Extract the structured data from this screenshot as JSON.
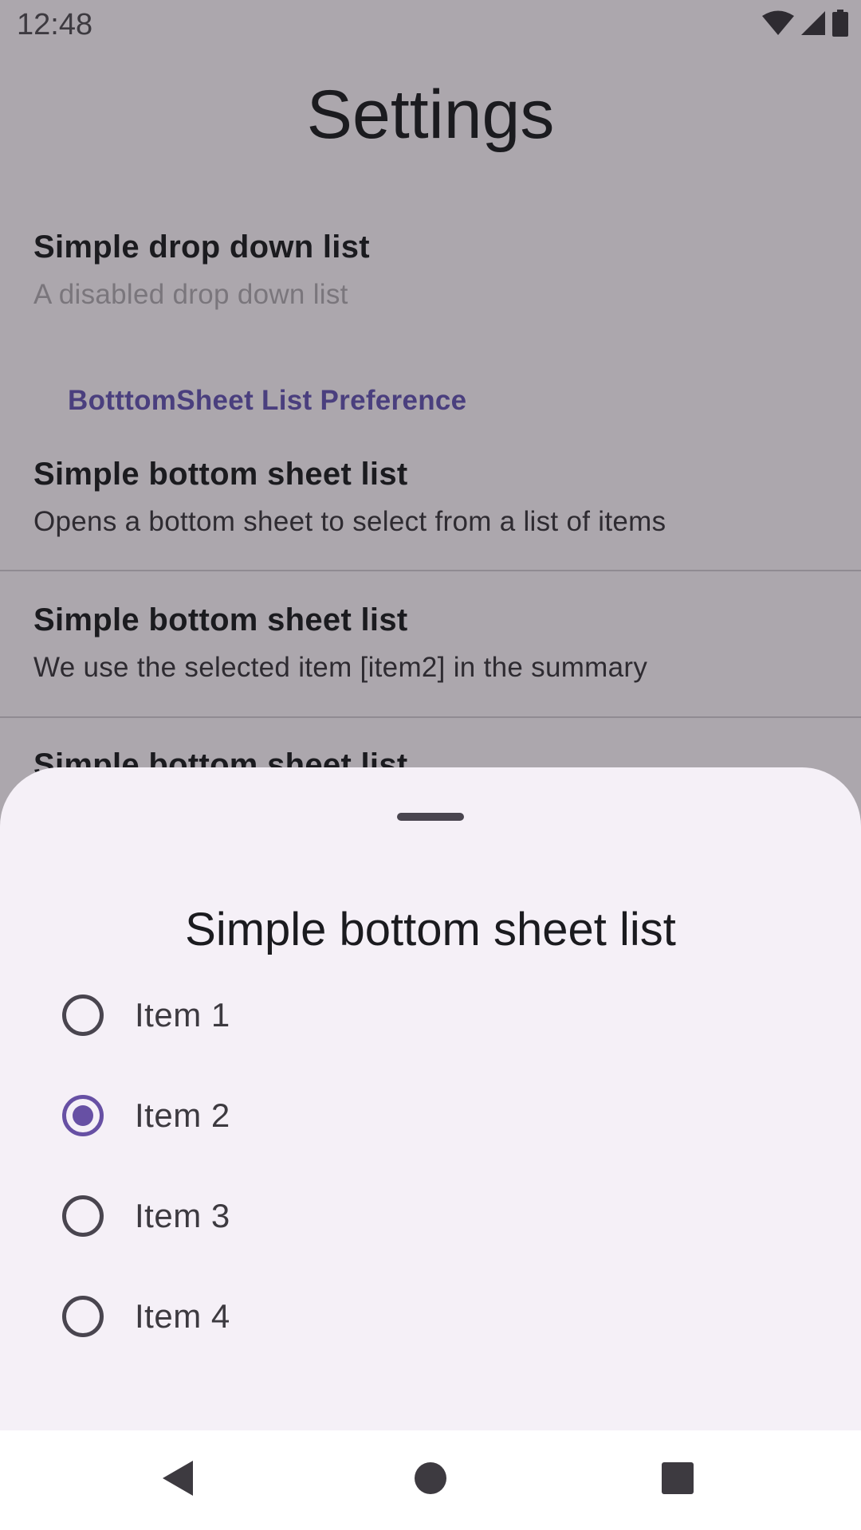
{
  "status_bar": {
    "time": "12:48",
    "icons": [
      "wifi-icon",
      "cell-signal-icon",
      "battery-icon"
    ]
  },
  "page": {
    "title": "Settings"
  },
  "preferences": {
    "dropdown": {
      "title": "Simple drop down list",
      "summary": "A disabled drop down list",
      "enabled": false
    },
    "category": {
      "title": "BotttomSheet List Preference"
    },
    "items": [
      {
        "title": "Simple bottom sheet list",
        "summary": "Opens a bottom sheet to select from a list of items"
      },
      {
        "title": "Simple bottom sheet list",
        "summary": "We use the selected item [item2] in the summary"
      },
      {
        "title": "Simple bottom sheet list",
        "summary": ""
      }
    ]
  },
  "bottom_sheet": {
    "title": "Simple bottom sheet list",
    "options": [
      {
        "label": "Item 1",
        "checked": false
      },
      {
        "label": "Item 2",
        "checked": true
      },
      {
        "label": "Item 3",
        "checked": false
      },
      {
        "label": "Item 4",
        "checked": false
      }
    ]
  },
  "nav_bar": {
    "buttons": [
      "back-icon",
      "home-icon",
      "recents-icon"
    ]
  },
  "colors": {
    "scrim_background": "#aca7ad",
    "sheet_background": "#f5f0f7",
    "accent": "#6750a4",
    "category_text": "#4a3f7e"
  }
}
